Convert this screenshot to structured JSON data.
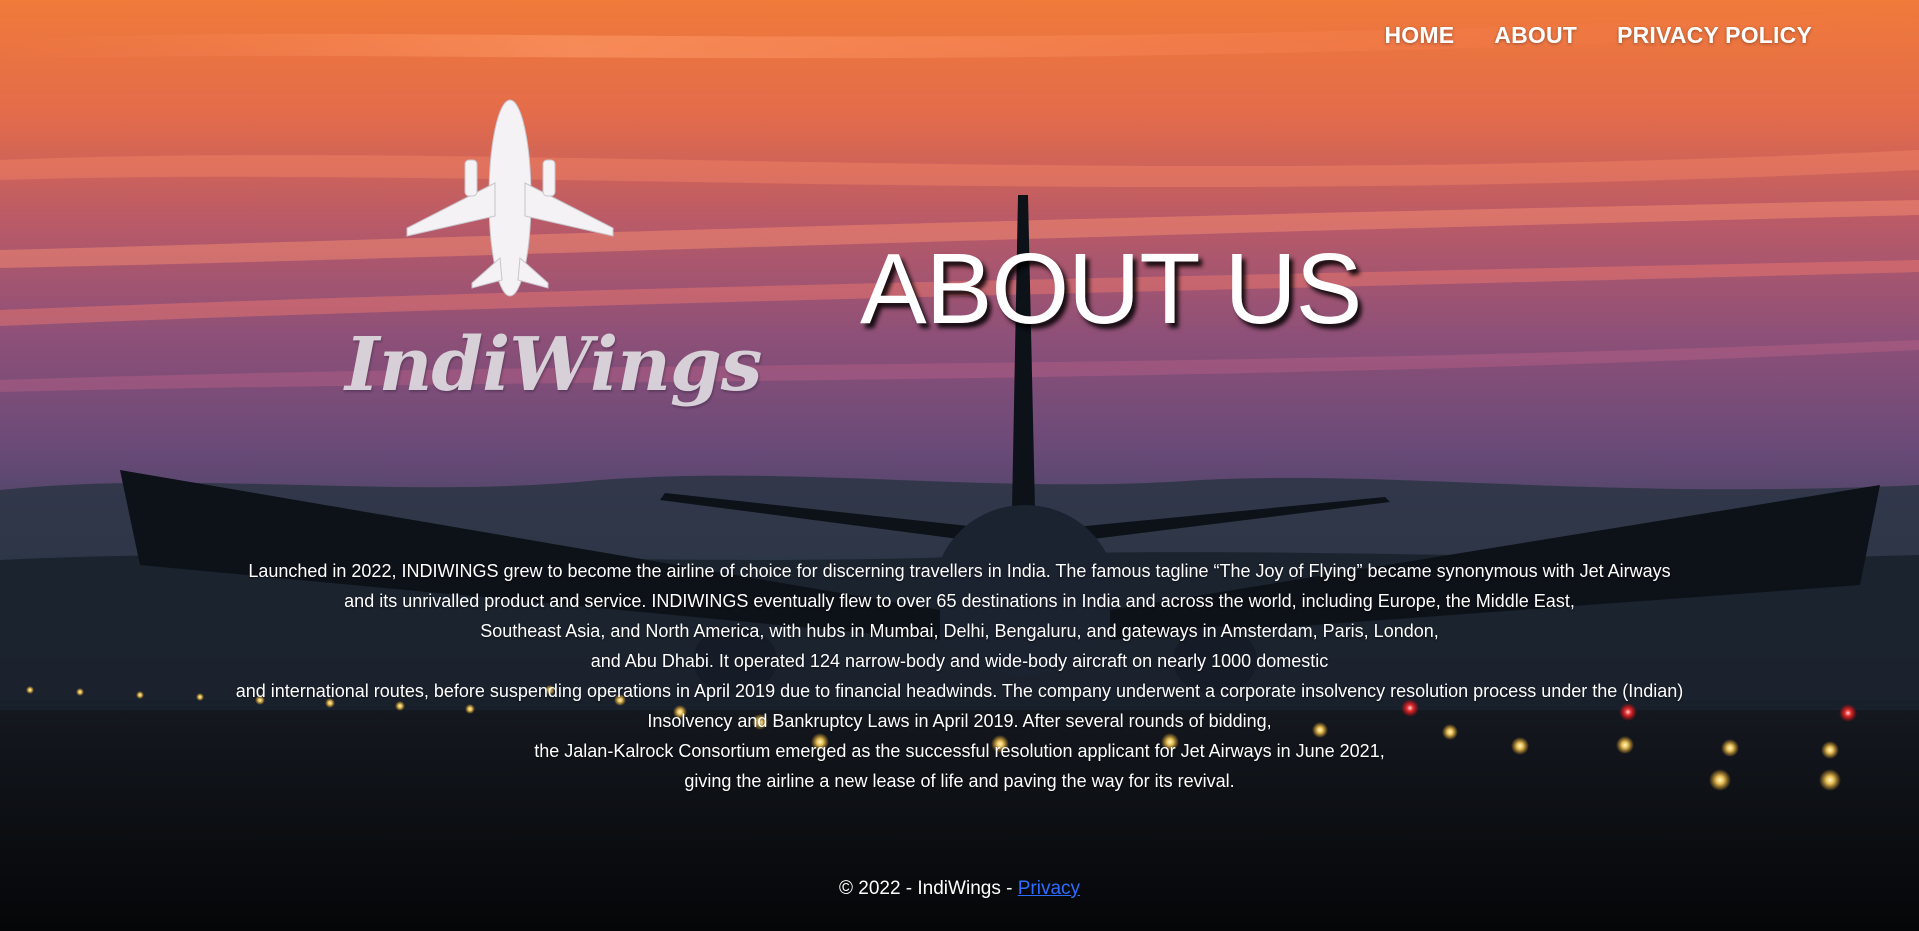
{
  "nav": {
    "items": [
      {
        "label": "HOME"
      },
      {
        "label": "ABOUT"
      },
      {
        "label": "PRIVACY POLICY"
      }
    ]
  },
  "logo": {
    "wordmark": "IndiWings",
    "icon": "airplane-icon"
  },
  "page_title": "ABOUT US",
  "about": {
    "lines": [
      "Launched in 2022, INDIWINGS grew to become the airline of choice for discerning travellers in India. The famous tagline “The Joy of Flying” became synonymous with Jet Airways",
      "and its unrivalled product and service. INDIWINGS eventually flew to over 65 destinations in India and across the world, including Europe, the Middle East,",
      "Southeast Asia, and North America, with hubs in Mumbai, Delhi, Bengaluru, and gateways in Amsterdam, Paris, London,",
      "and Abu Dhabi. It operated 124 narrow-body and wide-body aircraft on nearly 1000 domestic",
      "and international routes, before suspending operations in April 2019 due to financial headwinds. The company underwent a corporate insolvency resolution process under the (Indian)",
      "Insolvency and Bankruptcy Laws in April 2019. After several rounds of bidding,",
      "the Jalan-Kalrock Consortium emerged as the successful resolution applicant for Jet Airways in June 2021,",
      "giving the airline a new lease of life and paving the way for its revival."
    ]
  },
  "footer": {
    "copyright": "© 2022 - IndiWings - ",
    "privacy_link": "Privacy"
  },
  "colors": {
    "link": "#2d6cff",
    "text": "#ffffff"
  }
}
